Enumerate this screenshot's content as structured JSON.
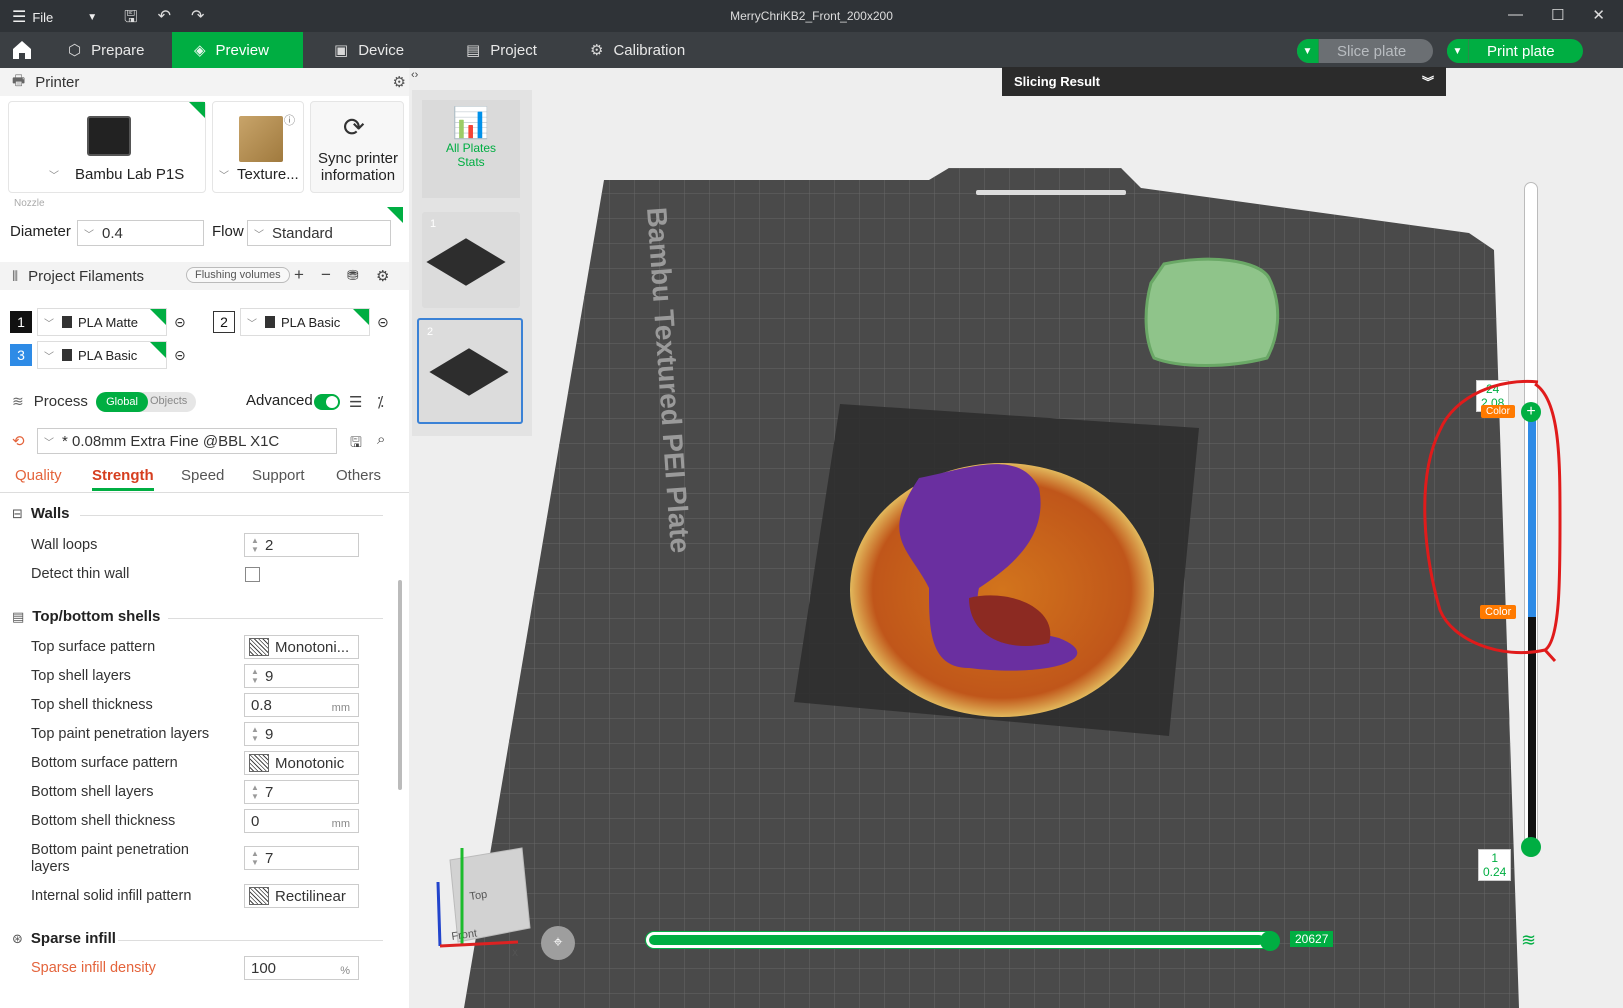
{
  "window": {
    "title": "MerryChriKB2_Front_200x200",
    "menu_label": "File"
  },
  "nav": {
    "tabs": [
      "Prepare",
      "Preview",
      "Device",
      "Project",
      "Calibration"
    ],
    "active": "Preview",
    "slice_label": "Slice plate",
    "print_label": "Print plate"
  },
  "printer": {
    "section_title": "Printer",
    "name": "Bambu Lab P1S",
    "plate": "Texture...",
    "sync_label_1": "Sync printer",
    "sync_label_2": "information",
    "nozzle_label": "Nozzle",
    "diameter_label": "Diameter",
    "diameter_value": "0.4",
    "flow_label": "Flow",
    "flow_value": "Standard"
  },
  "filaments": {
    "section_title": "Project Filaments",
    "flushing_label": "Flushing volumes",
    "items": [
      {
        "num": "1",
        "name": "PLA Matte",
        "color": "#111111",
        "text_color": "#ffffff"
      },
      {
        "num": "2",
        "name": "PLA Basic",
        "color": "#ffffff",
        "text_color": "#111111"
      },
      {
        "num": "3",
        "name": "PLA Basic",
        "color": "#2e8be6",
        "text_color": "#ffffff"
      }
    ]
  },
  "process": {
    "section_title": "Process",
    "global_label": "Global",
    "objects_label": "Objects",
    "advanced_label": "Advanced",
    "preset": "* 0.08mm Extra Fine @BBL X1C",
    "tabs": [
      "Quality",
      "Strength",
      "Speed",
      "Support",
      "Others"
    ],
    "active_tab": "Strength"
  },
  "settings": {
    "walls_title": "Walls",
    "wall_loops_label": "Wall loops",
    "wall_loops_value": "2",
    "thin_wall_label": "Detect thin wall",
    "shells_title": "Top/bottom shells",
    "top_pattern_label": "Top surface pattern",
    "top_pattern_value": "Monotoni...",
    "top_layers_label": "Top shell layers",
    "top_layers_value": "9",
    "top_thick_label": "Top shell thickness",
    "top_thick_value": "0.8",
    "top_paint_label": "Top paint penetration layers",
    "top_paint_value": "9",
    "bottom_pattern_label": "Bottom surface pattern",
    "bottom_pattern_value": "Monotonic",
    "bottom_layers_label": "Bottom shell layers",
    "bottom_layers_value": "7",
    "bottom_thick_label": "Bottom shell thickness",
    "bottom_thick_value": "0",
    "bottom_paint_label_1": "Bottom paint penetration",
    "bottom_paint_label_2": "layers",
    "bottom_paint_value": "7",
    "internal_pattern_label": "Internal solid infill pattern",
    "internal_pattern_value": "Rectilinear",
    "sparse_title": "Sparse infill",
    "sparse_density_label": "Sparse infill density",
    "sparse_density_value": "100",
    "unit_mm": "mm",
    "unit_pct": "%"
  },
  "preview": {
    "all_plates_1": "All Plates",
    "all_plates_2": "Stats",
    "plate_nums": [
      "1",
      "2"
    ],
    "slicing_result": "Slicing Result",
    "bed_label": "Bambu Textured PEI Plate",
    "layer_top_num": "24",
    "layer_top_height": "2.08",
    "layer_bottom_num": "1",
    "layer_bottom_height": "0.24",
    "color_tag": "Color",
    "move_value": "20627",
    "cube_top": "Top",
    "cube_front": "Front",
    "axis_x": "X"
  }
}
